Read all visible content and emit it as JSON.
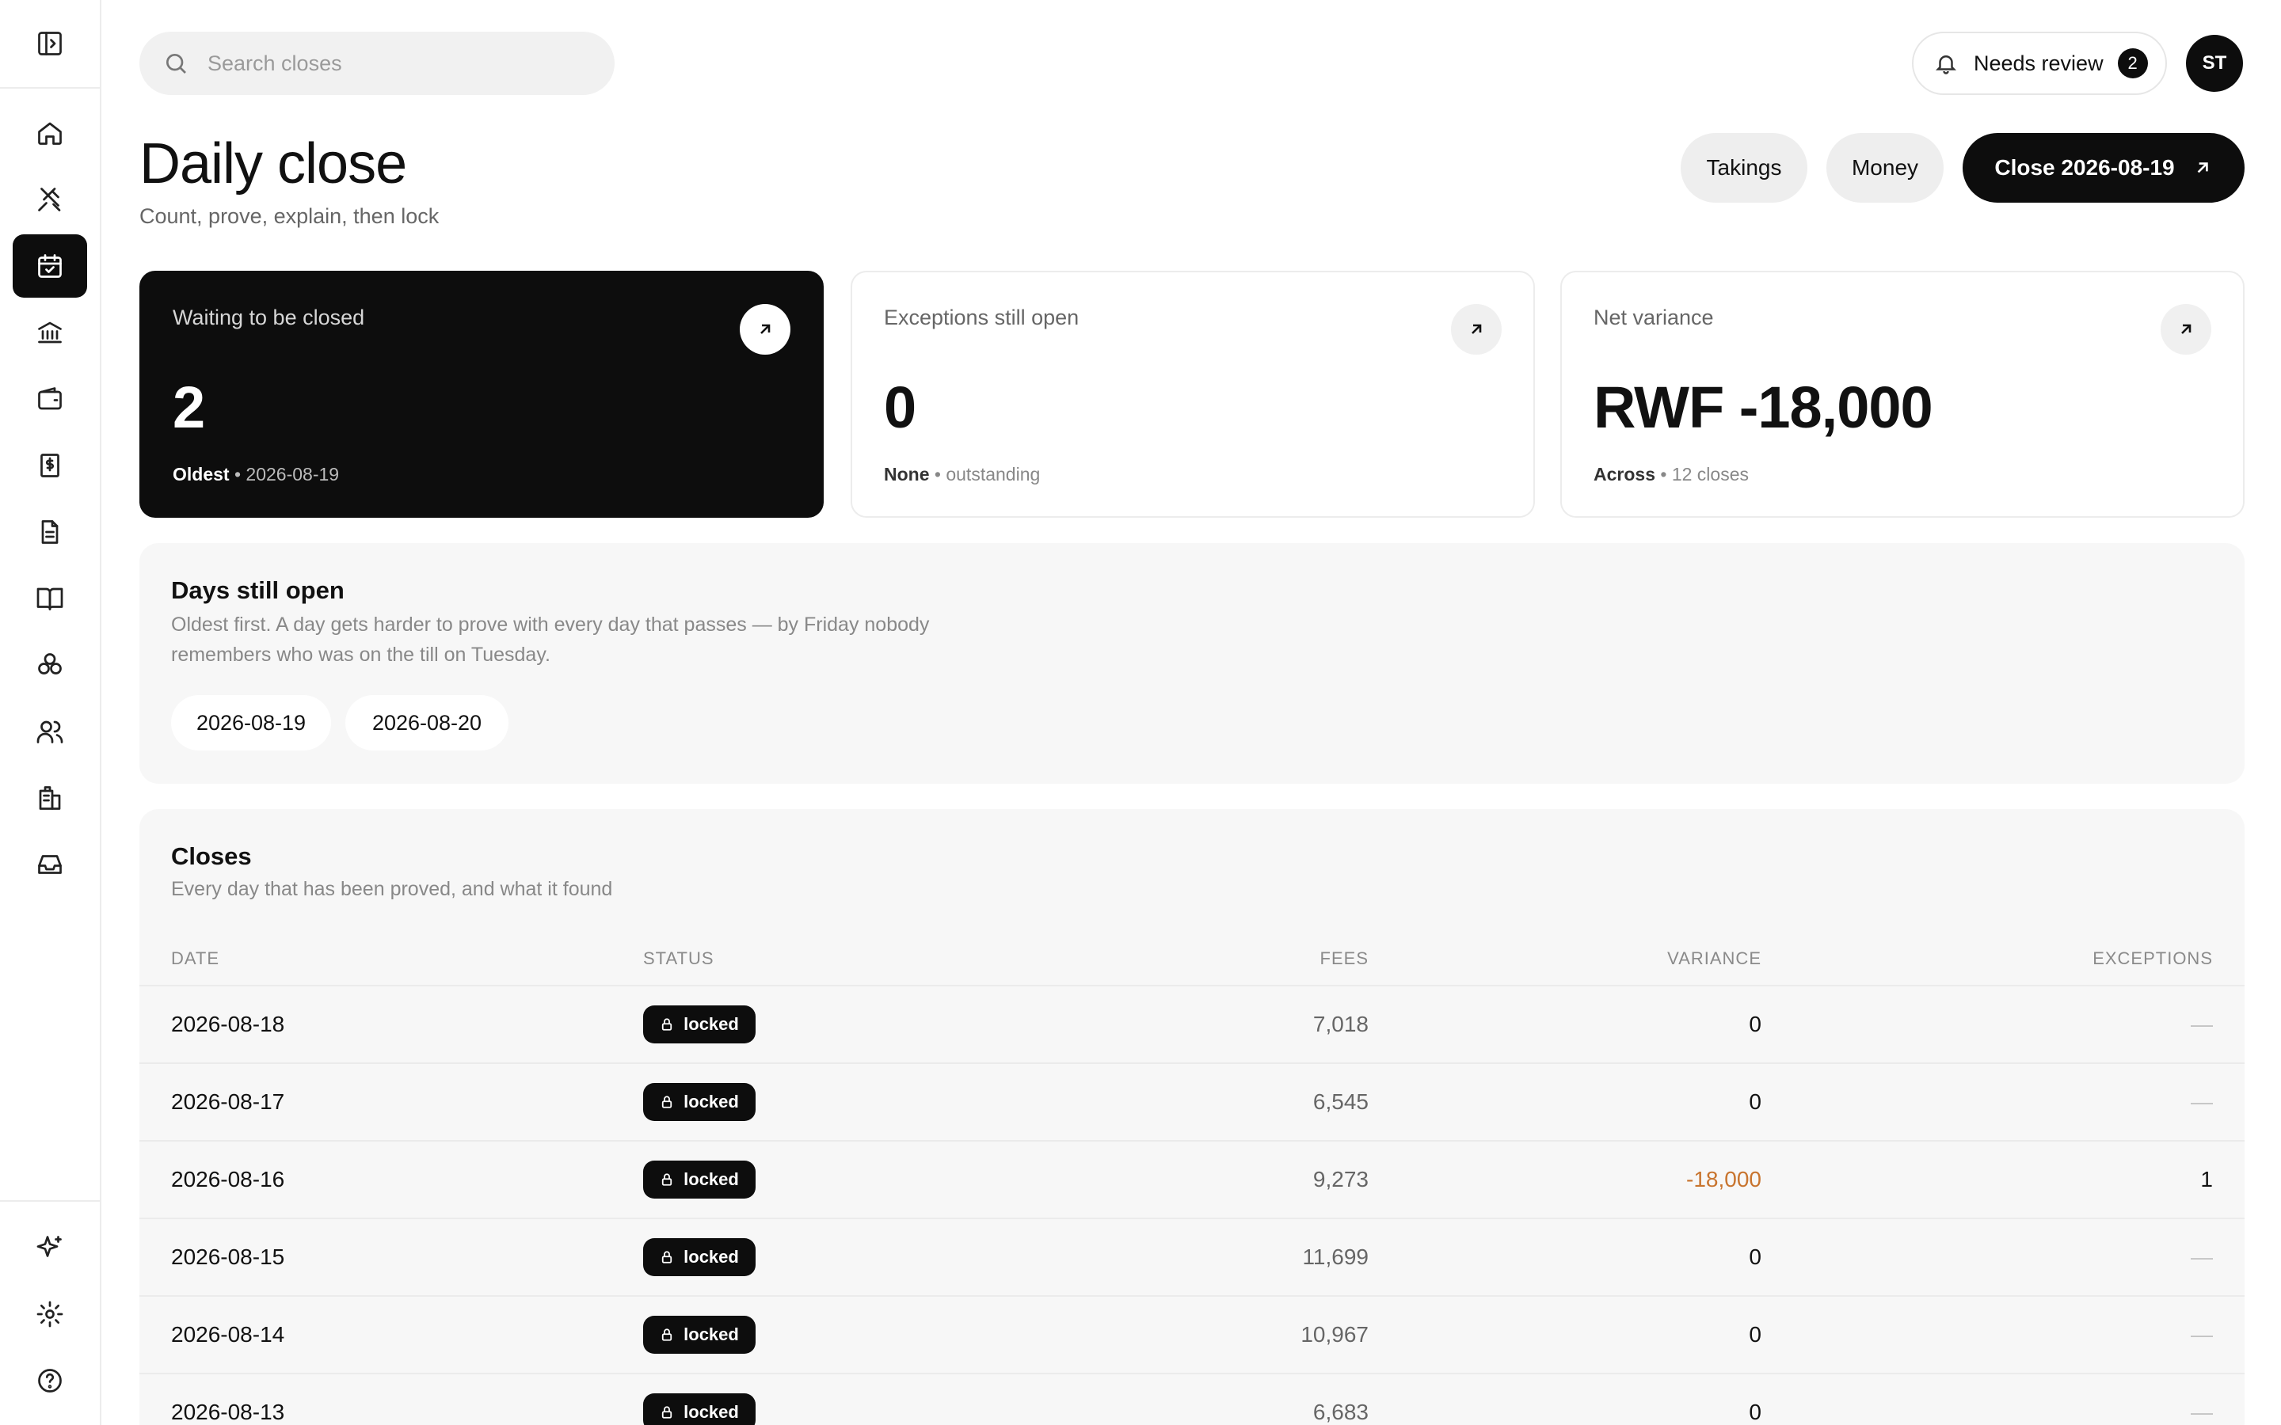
{
  "search": {
    "placeholder": "Search closes"
  },
  "topbar": {
    "needs_review_label": "Needs review",
    "needs_review_count": "2",
    "avatar_initials": "ST"
  },
  "header": {
    "title": "Daily close",
    "subtitle": "Count, prove, explain, then lock",
    "takings_label": "Takings",
    "money_label": "Money",
    "close_label": "Close 2026-08-19"
  },
  "sidebar": {
    "items": [
      "toggle-sidebar",
      "home",
      "restaurant",
      "daily-close",
      "bank",
      "wallet",
      "invoice",
      "document",
      "book",
      "ingredients",
      "people",
      "buildings",
      "inbox",
      "sparkles",
      "settings",
      "help"
    ],
    "active": "daily-close"
  },
  "cards": [
    {
      "label": "Waiting to be closed",
      "value": "2",
      "foot_strong": "Oldest",
      "foot_rest": "2026-08-19"
    },
    {
      "label": "Exceptions still open",
      "value": "0",
      "foot_strong": "None",
      "foot_rest": "outstanding"
    },
    {
      "label": "Net variance",
      "value": "RWF -18,000",
      "foot_strong": "Across",
      "foot_rest": "12 closes"
    }
  ],
  "days_open": {
    "title": "Days still open",
    "description": "Oldest first. A day gets harder to prove with every day that passes — by Friday nobody remembers who was on the till on Tuesday.",
    "chips": [
      "2026-08-19",
      "2026-08-20"
    ]
  },
  "closes": {
    "title": "Closes",
    "subtitle": "Every day that has been proved, and what it found",
    "columns": {
      "date": "DATE",
      "status": "STATUS",
      "fees": "FEES",
      "variance": "VARIANCE",
      "exceptions": "EXCEPTIONS"
    },
    "rows": [
      {
        "date": "2026-08-18",
        "status": "locked",
        "fees": "7,018",
        "variance": "0",
        "exceptions": "—"
      },
      {
        "date": "2026-08-17",
        "status": "locked",
        "fees": "6,545",
        "variance": "0",
        "exceptions": "—"
      },
      {
        "date": "2026-08-16",
        "status": "locked",
        "fees": "9,273",
        "variance": "-18,000",
        "exceptions": "1"
      },
      {
        "date": "2026-08-15",
        "status": "locked",
        "fees": "11,699",
        "variance": "0",
        "exceptions": "—"
      },
      {
        "date": "2026-08-14",
        "status": "locked",
        "fees": "10,967",
        "variance": "0",
        "exceptions": "—"
      },
      {
        "date": "2026-08-13",
        "status": "locked",
        "fees": "6,683",
        "variance": "0",
        "exceptions": "—"
      }
    ]
  },
  "colors": {
    "accent_dark": "#0d0d0d",
    "negative_variance": "#c8742e",
    "panel_bg": "#f7f7f7"
  }
}
